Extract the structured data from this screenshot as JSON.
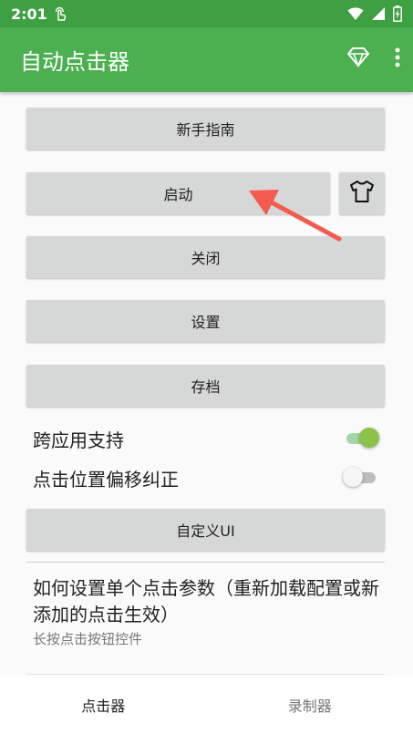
{
  "status_bar": {
    "time": "2:01"
  },
  "app_bar": {
    "title": "自动点击器"
  },
  "buttons": {
    "guide": "新手指南",
    "start": "启动",
    "stop": "关闭",
    "settings": "设置",
    "save": "存档",
    "custom_ui": "自定义UI"
  },
  "toggles": [
    {
      "label": "跨应用支持",
      "on": true
    },
    {
      "label": "点击位置偏移纠正",
      "on": false
    }
  ],
  "info": {
    "title": "如何设置单个点击参数（重新加载配置或新添加的点击生效）",
    "subtitle": "长按点击按钮控件"
  },
  "bottom_nav": [
    {
      "label": "点击器",
      "active": true
    },
    {
      "label": "录制器",
      "active": false
    }
  ],
  "colors": {
    "status_bar": "#3e9f43",
    "app_bar": "#4caf50",
    "toggle_on_thumb": "#8bc34a",
    "toggle_on_track": "#a5d6a7",
    "toggle_off_thumb": "#f5f5f5",
    "toggle_off_track": "#bdbdbd",
    "annotation_arrow": "#f45b4f"
  },
  "icons": [
    "touch-icon",
    "wifi-icon",
    "signal-icon",
    "battery-icon",
    "diamond-icon",
    "more-vert-icon",
    "tshirt-icon"
  ]
}
